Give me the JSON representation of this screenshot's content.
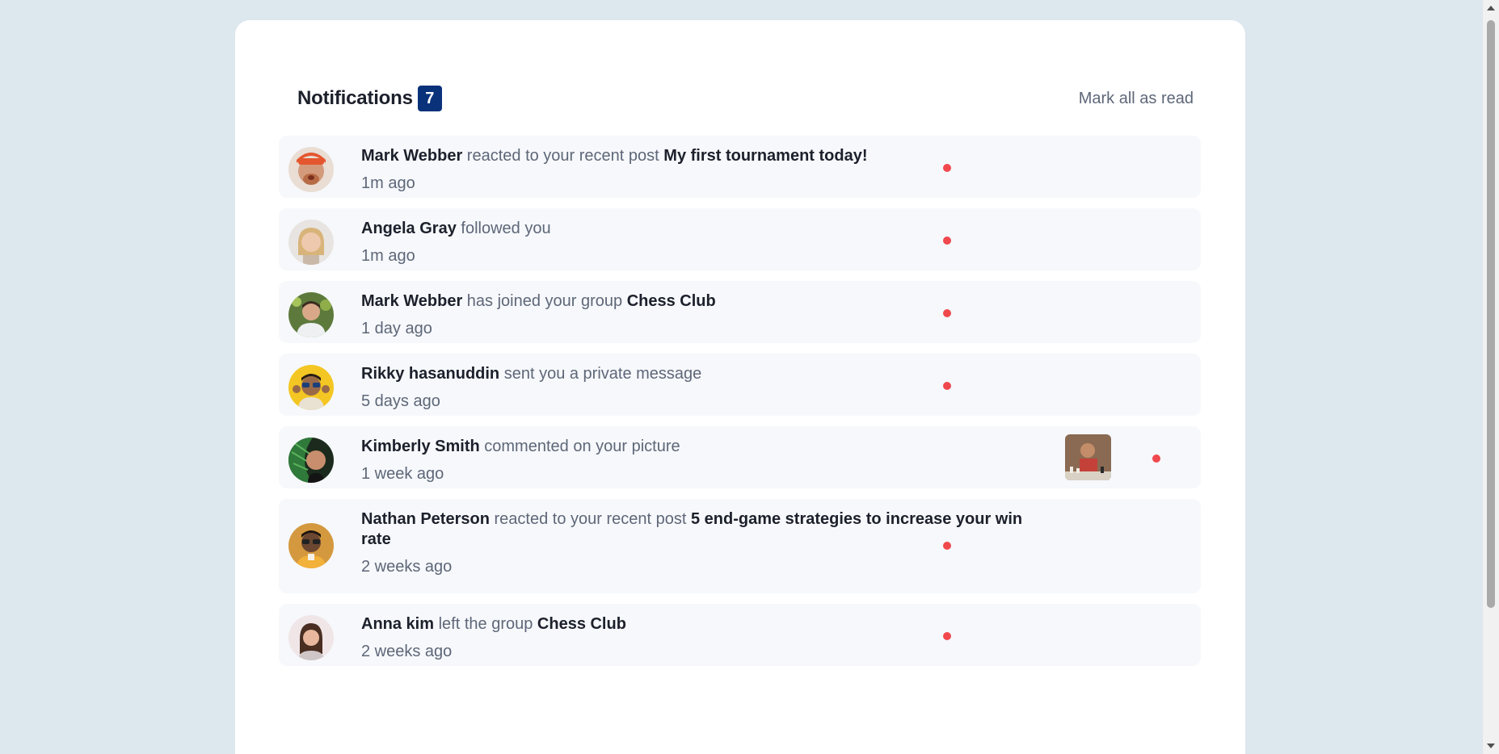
{
  "header": {
    "title": "Notifications",
    "count": "7",
    "mark_all_label": "Mark all as read"
  },
  "notifications": [
    {
      "name": "Mark Webber",
      "action": "reacted to your recent post",
      "target": "My first tournament today!",
      "time": "1m ago",
      "unread": true,
      "has_picture": false
    },
    {
      "name": "Angela Gray",
      "action": "followed you",
      "target": "",
      "time": "1m ago",
      "unread": true,
      "has_picture": false
    },
    {
      "name": "Mark Webber",
      "action": "has joined your group",
      "target": "Chess Club",
      "time": "1 day ago",
      "unread": true,
      "has_picture": false
    },
    {
      "name": "Rikky hasanuddin",
      "action": "sent you a private message",
      "target": "",
      "time": "5 days ago",
      "unread": true,
      "has_picture": false
    },
    {
      "name": "Kimberly Smith",
      "action": "commented on your picture",
      "target": "",
      "time": "1 week ago",
      "unread": true,
      "has_picture": true
    },
    {
      "name": "Nathan Peterson",
      "action": "reacted to your recent post",
      "target": "5 end-game strategies to increase your win rate",
      "time": "2 weeks ago",
      "unread": true,
      "has_picture": false
    },
    {
      "name": "Anna kim",
      "action": "left the group",
      "target": "Chess Club",
      "time": "2 weeks ago",
      "unread": true,
      "has_picture": false
    }
  ],
  "colors": {
    "badge": "#0a327b",
    "unread_dot": "#f0484d",
    "item_background": "#f6f8fb",
    "page_background": "#dde7ee"
  },
  "icons": [
    "avatar-photo",
    "chess-picture-thumbnail",
    "unread-dot-icon"
  ]
}
